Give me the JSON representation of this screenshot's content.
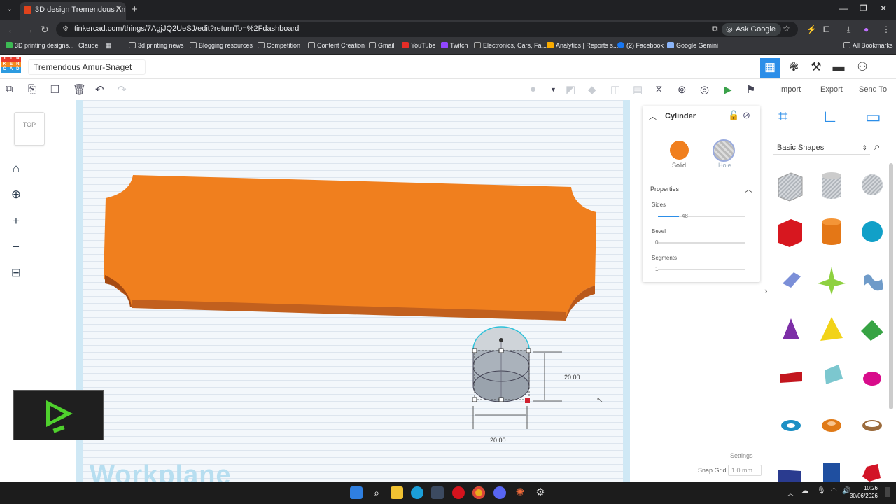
{
  "browser": {
    "tab_title": "3D design Tremendous Amur-S",
    "url": "tinkercad.com/things/7AgjJQ2UeSJ/edit?returnTo=%2Fdashboard",
    "ask_google": "Ask Google",
    "bookmarks": [
      "3D printing designs...",
      "Claude",
      "3d printing news",
      "Blogging resources",
      "Competition",
      "Content Creation",
      "Gmail",
      "YouTube",
      "Twitch",
      "Electronics, Cars, Fa...",
      "Analytics | Reports s...",
      "(2) Facebook",
      "Google Gemini"
    ],
    "all_bookmarks": "All Bookmarks"
  },
  "app": {
    "logo_letters": [
      "T",
      "I",
      "N",
      "K",
      "E",
      "R",
      "C",
      "A",
      "D"
    ],
    "design_name": "Tremendous Amur-Snaget",
    "tabs": {
      "import": "Import",
      "export": "Export",
      "send_to": "Send To"
    }
  },
  "workplane": {
    "viewcube": "TOP",
    "label": "Workplane",
    "dim_width": "20.00",
    "dim_height": "20.00",
    "settings": "Settings",
    "snap_grid_label": "Snap Grid",
    "snap_grid_value": "1.0 mm"
  },
  "inspector": {
    "title": "Cylinder",
    "solid": "Solid",
    "hole": "Hole",
    "properties": "Properties",
    "sides_label": "Sides",
    "sides_value": "48",
    "sides_fraction": 0.24,
    "bevel_label": "Bevel",
    "bevel_value": "0",
    "bevel_fraction": 0,
    "segments_label": "Segments",
    "segments_value": "1",
    "segments_fraction": 0
  },
  "library": {
    "category": "Basic Shapes"
  },
  "taskbar": {
    "time": "10:26",
    "date": "30/06/2026"
  },
  "colors": {
    "accent": "#2c8ee8",
    "plate": "#f07f1e",
    "solid": "#f07f1e"
  }
}
